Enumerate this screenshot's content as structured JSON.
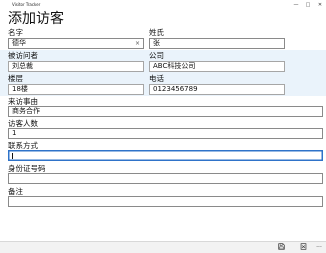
{
  "app": {
    "title": "Visitor Tracker"
  },
  "window_controls": {
    "minimize": "—",
    "maximize": "□",
    "close": "✕"
  },
  "page_title": "添加访客",
  "form": {
    "name": {
      "label": "名字",
      "value": "德华"
    },
    "surname": {
      "label": "姓氏",
      "value": "张"
    },
    "visitee": {
      "label": "被访问者",
      "value": "刘总裁"
    },
    "company": {
      "label": "公司",
      "value": "ABC科技公司"
    },
    "floor": {
      "label": "楼层",
      "value": "18楼"
    },
    "phone": {
      "label": "电话",
      "value": "0123456789"
    },
    "reason": {
      "label": "来访事由",
      "value": "商务合作"
    },
    "visitor_count": {
      "label": "访客人数",
      "value": "1"
    },
    "contact": {
      "label": "联系方式",
      "value": ""
    },
    "id_number": {
      "label": "身份证号码",
      "value": ""
    },
    "notes": {
      "label": "备注",
      "value": ""
    }
  },
  "icons": {
    "clear": "×",
    "more": "···",
    "save": "save-icon",
    "cancel": "cancel-icon"
  },
  "bottom_bar": {
    "more_label": "···"
  },
  "colors": {
    "focus_border": "#2f73c9",
    "readonly_band": "#eaf3fb"
  }
}
